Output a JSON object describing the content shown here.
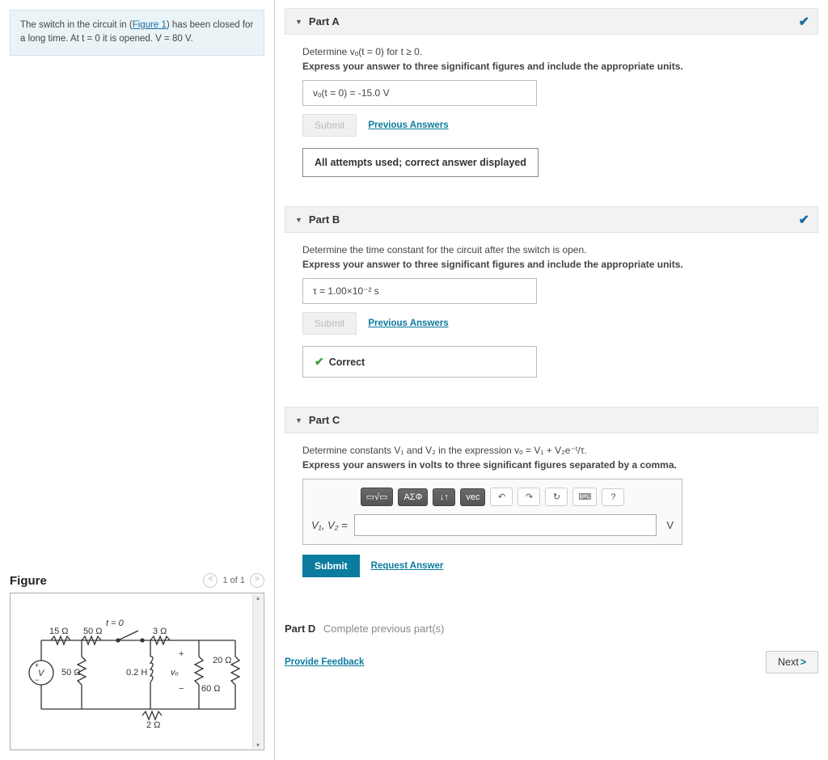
{
  "intro": {
    "text_prefix": "The switch in the circuit in (",
    "figure_link": "Figure 1",
    "text_suffix": ") has been closed for a long time. At t = 0 it is opened. V = 80 V."
  },
  "figure": {
    "title": "Figure",
    "pager": "1 of 1",
    "labels": {
      "t0": "t = 0",
      "r15": "15 Ω",
      "r50a": "50 Ω",
      "r3": "3 Ω",
      "r50b": "50 Ω",
      "h": "0.2 H",
      "vo_plus": "+",
      "vo_minus": "−",
      "vo": "vₒ",
      "r20": "20 Ω",
      "r60": "60 Ω",
      "r2": "2 Ω",
      "V": "V"
    }
  },
  "partA": {
    "title": "Part A",
    "prompt": "Determine vₒ(t = 0) for t ≥ 0.",
    "instr": "Express your answer to three significant figures and include the appropriate units.",
    "answer": "vₒ(t = 0) =  -15.0 V",
    "submit": "Submit",
    "prev": "Previous Answers",
    "feedback": "All attempts used; correct answer displayed"
  },
  "partB": {
    "title": "Part B",
    "prompt": "Determine the time constant for the circuit after the switch is open.",
    "instr": "Express your answer to three significant figures and include the appropriate units.",
    "answer": "τ =  1.00×10⁻² s",
    "submit": "Submit",
    "prev": "Previous Answers",
    "feedback": "Correct"
  },
  "partC": {
    "title": "Part C",
    "prompt": "Determine constants V₁ and V₂ in the expression vₒ = V₁ + V₂e⁻ᵗ/τ.",
    "instr": "Express your answers in volts to three significant figures separated by a comma.",
    "var_label": "V₁, V₂ =",
    "unit": "V",
    "submit": "Submit",
    "request": "Request Answer",
    "toolbar": {
      "templates": "▭√▭",
      "greek": "ΑΣΦ",
      "arrows": "↓↑",
      "vec": "vec",
      "undo": "↶",
      "redo": "↷",
      "reset": "↻",
      "keyboard": "⌨",
      "help": "?"
    }
  },
  "partD": {
    "title": "Part D",
    "status": "Complete previous part(s)"
  },
  "footer": {
    "feedback": "Provide Feedback",
    "next": "Next"
  }
}
